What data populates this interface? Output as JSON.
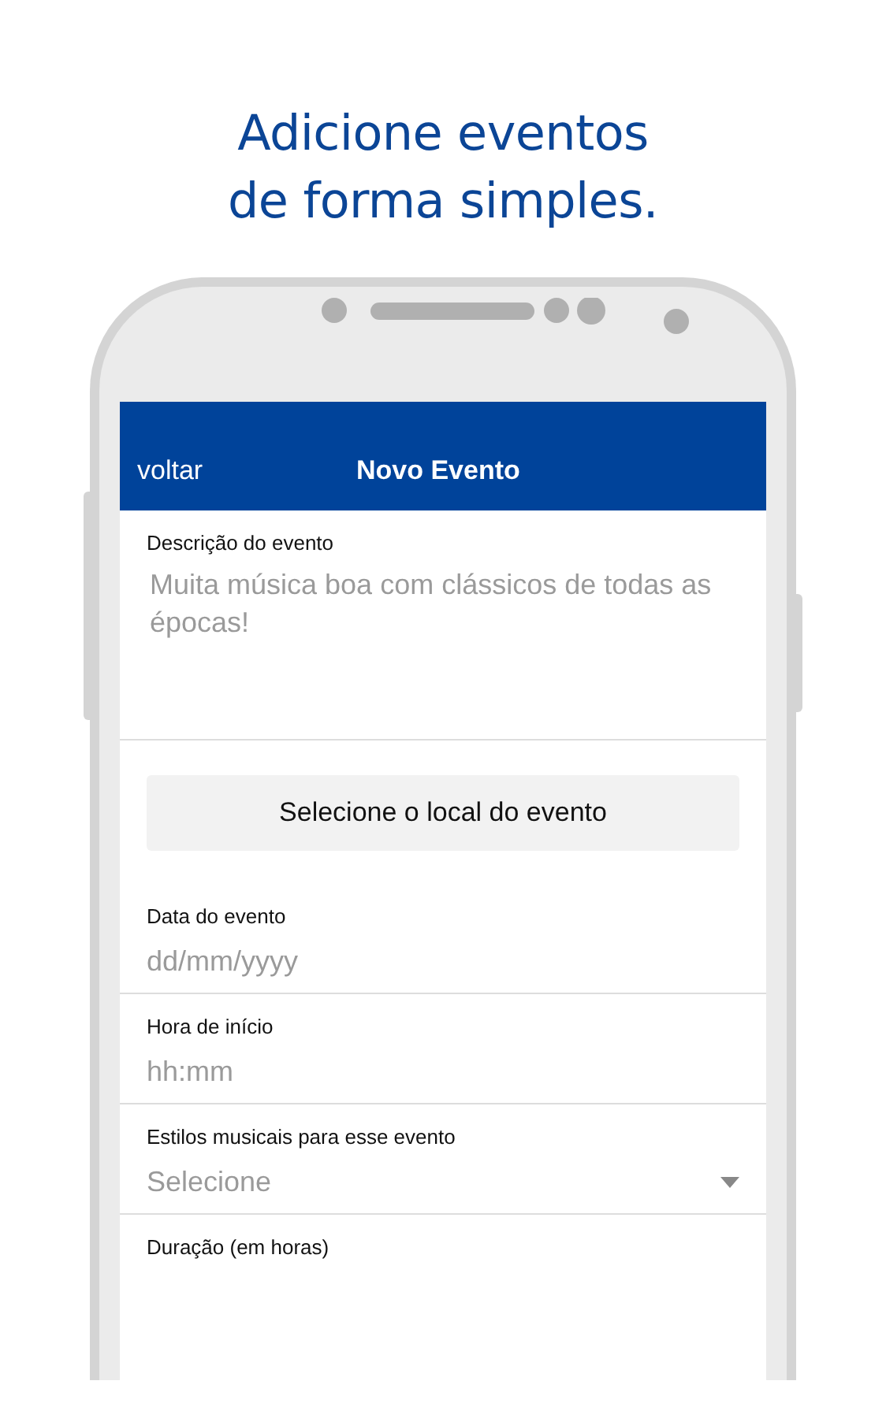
{
  "headline": [
    "Adicione eventos",
    "de forma simples."
  ],
  "header": {
    "back": "voltar",
    "title": "Novo Evento"
  },
  "description": {
    "label": "Descrição do evento",
    "placeholder": "Muita música boa com clássicos de todas as épocas!"
  },
  "location_button": "Selecione o local do evento",
  "fields": [
    {
      "kind": "text",
      "label": "Data do evento",
      "placeholder": "dd/mm/yyyy"
    },
    {
      "kind": "text",
      "label": "Hora de início",
      "placeholder": "hh:mm"
    },
    {
      "kind": "select",
      "label": "Estilos musicais para esse evento",
      "placeholder": "Selecione"
    },
    {
      "kind": "label",
      "label": "Duração (em horas)"
    }
  ]
}
